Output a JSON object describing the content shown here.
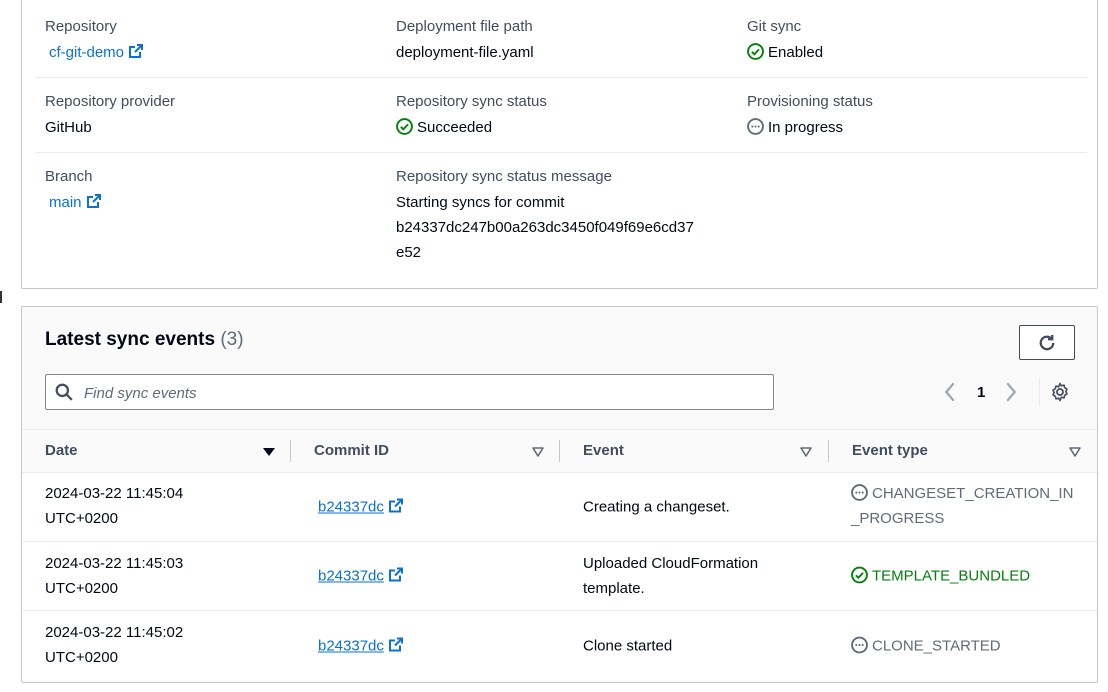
{
  "details": {
    "repository": {
      "label": "Repository",
      "value": "cf-git-demo"
    },
    "deployment_file_path": {
      "label": "Deployment file path",
      "value": "deployment-file.yaml"
    },
    "git_sync": {
      "label": "Git sync",
      "value": "Enabled"
    },
    "repository_provider": {
      "label": "Repository provider",
      "value": "GitHub"
    },
    "repository_sync_status": {
      "label": "Repository sync status",
      "value": "Succeeded"
    },
    "provisioning_status": {
      "label": "Provisioning status",
      "value": "In progress"
    },
    "branch": {
      "label": "Branch",
      "value": "main"
    },
    "sync_status_message": {
      "label": "Repository sync status message",
      "line1": "Starting syncs for commit",
      "line2": "b24337dc247b00a263dc3450f049f69e6cd37",
      "line3": "e52"
    }
  },
  "events": {
    "title": "Latest sync events",
    "count": "(3)",
    "search_placeholder": "Find sync events",
    "page": "1",
    "columns": [
      "Date",
      "Commit ID",
      "Event",
      "Event type"
    ],
    "rows": [
      {
        "date_line1": "2024-03-22 11:45:04",
        "date_line2": "UTC+0200",
        "commit": "b24337dc",
        "event_line1": "Creating a changeset.",
        "event_line2": "",
        "type_line1": "CHANGESET_CREATION_IN",
        "type_line2": "_PROGRESS"
      },
      {
        "date_line1": "2024-03-22 11:45:03",
        "date_line2": "UTC+0200",
        "commit": "b24337dc",
        "event_line1": "Uploaded CloudFormation",
        "event_line2": "template.",
        "type_line1": "TEMPLATE_BUNDLED",
        "type_line2": ""
      },
      {
        "date_line1": "2024-03-22 11:45:02",
        "date_line2": "UTC+0200",
        "commit": "b24337dc",
        "event_line1": "Clone started",
        "event_line2": "",
        "type_line1": "CLONE_STARTED",
        "type_line2": ""
      }
    ]
  },
  "colors": {
    "link": "#0972d3",
    "success": "#037f0c",
    "in_progress": "#5f6b7a",
    "border": "#c6c6cd"
  }
}
